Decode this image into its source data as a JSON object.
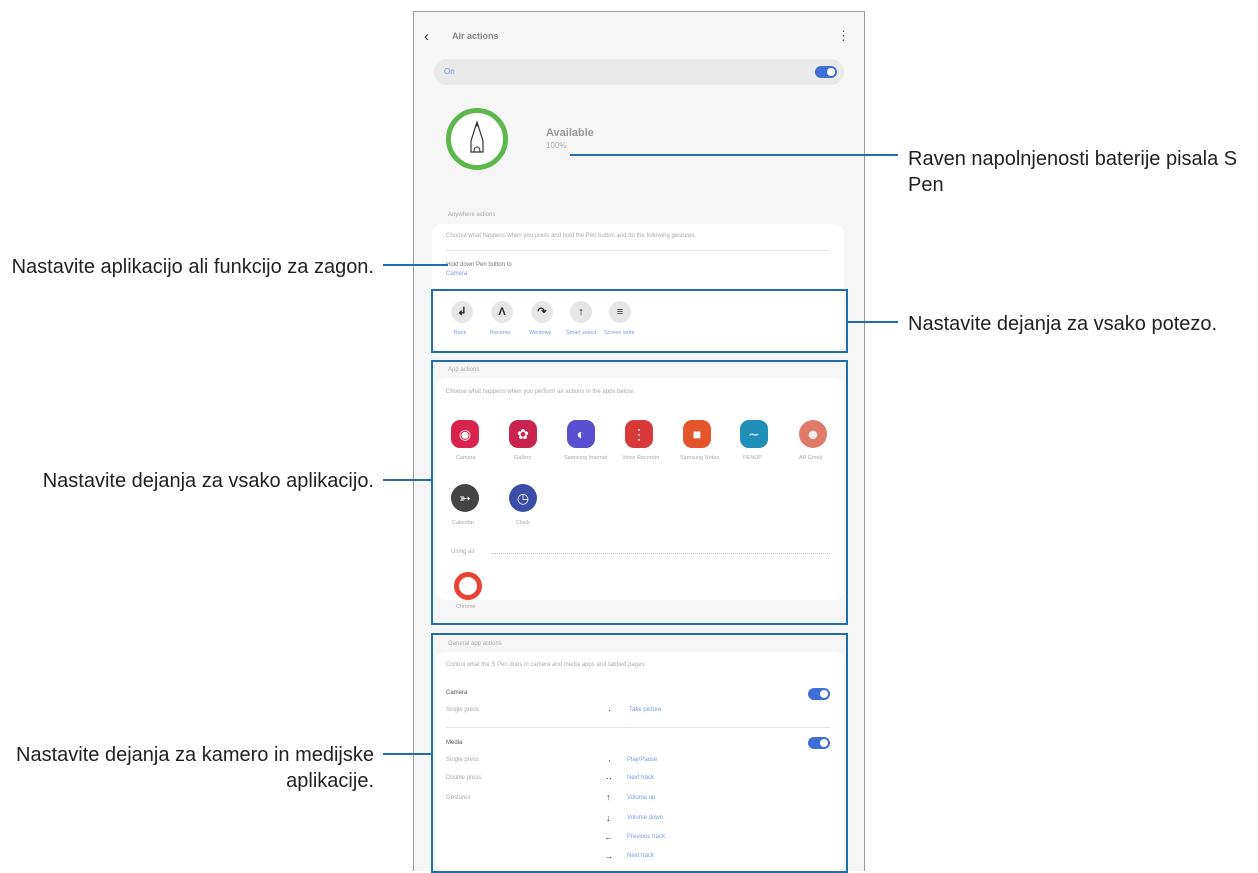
{
  "screen": {
    "title": "Air actions",
    "on_label": "On",
    "status": "Available",
    "battery": "100%",
    "anywhere_section": "Anywhere actions",
    "anywhere_desc": "Choose what happens when you press and hold the Pen button and do the following gestures.",
    "hold_label": "Hold down Pen button to",
    "hold_value": "Camera",
    "gestures": [
      "Back",
      "Recents",
      "Windows",
      "Smart select",
      "Screen write"
    ],
    "app_section": "App actions",
    "app_desc": "Choose what happens when you perform air actions in the apps below.",
    "apps": [
      "Camera",
      "Gallery",
      "Samsung Internet",
      "Voice Recorder",
      "Samsung Notes",
      "PENUP",
      "AR Emoji",
      "Calendar",
      "Clock"
    ],
    "other_apps_label": "Using air",
    "other_apps": [
      "Chrome"
    ],
    "general_section": "General app actions",
    "general_desc": "Control what the S Pen does in camera and media apps and tabbed pages.",
    "camera_label": "Camera",
    "camera_rows": [
      {
        "label": "Single press",
        "action": "Take picture"
      }
    ],
    "media_label": "Media",
    "media_rows": [
      {
        "label": "Single press",
        "action": "Play/Pause"
      },
      {
        "label": "Double press",
        "action": "Next track"
      },
      {
        "label": "Gestures",
        "action": "Volume up"
      }
    ],
    "media_extra": [
      "Volume down",
      "Previous track",
      "Next track"
    ]
  },
  "annotations": {
    "battery": "Raven napolnjenosti baterije pisala S Pen",
    "launch": "Nastavite aplikacijo ali funkcijo za zagon.",
    "gestures": "Nastavite dejanja za vsako potezo.",
    "apps": "Nastavite dejanja za vsako aplikacijo.",
    "camera_media": "Nastavite dejanja za kamero in medijske aplikacije."
  },
  "colors": {
    "highlight": "#1f6fb0",
    "accent": "#3e6fd6",
    "pen_ring": "#5cb84a"
  },
  "icons": {
    "back": "chevron-left-icon",
    "more": "more-vert-icon",
    "gestures": [
      "back-gesture-icon",
      "recents-gesture-icon",
      "windows-gesture-icon",
      "smart-select-gesture-icon",
      "screen-write-gesture-icon"
    ],
    "apps": [
      "camera-icon",
      "gallery-icon",
      "internet-icon",
      "voice-recorder-icon",
      "notes-icon",
      "penup-icon",
      "ar-emoji-icon",
      "calendar-icon",
      "clock-icon",
      "chrome-icon"
    ]
  }
}
